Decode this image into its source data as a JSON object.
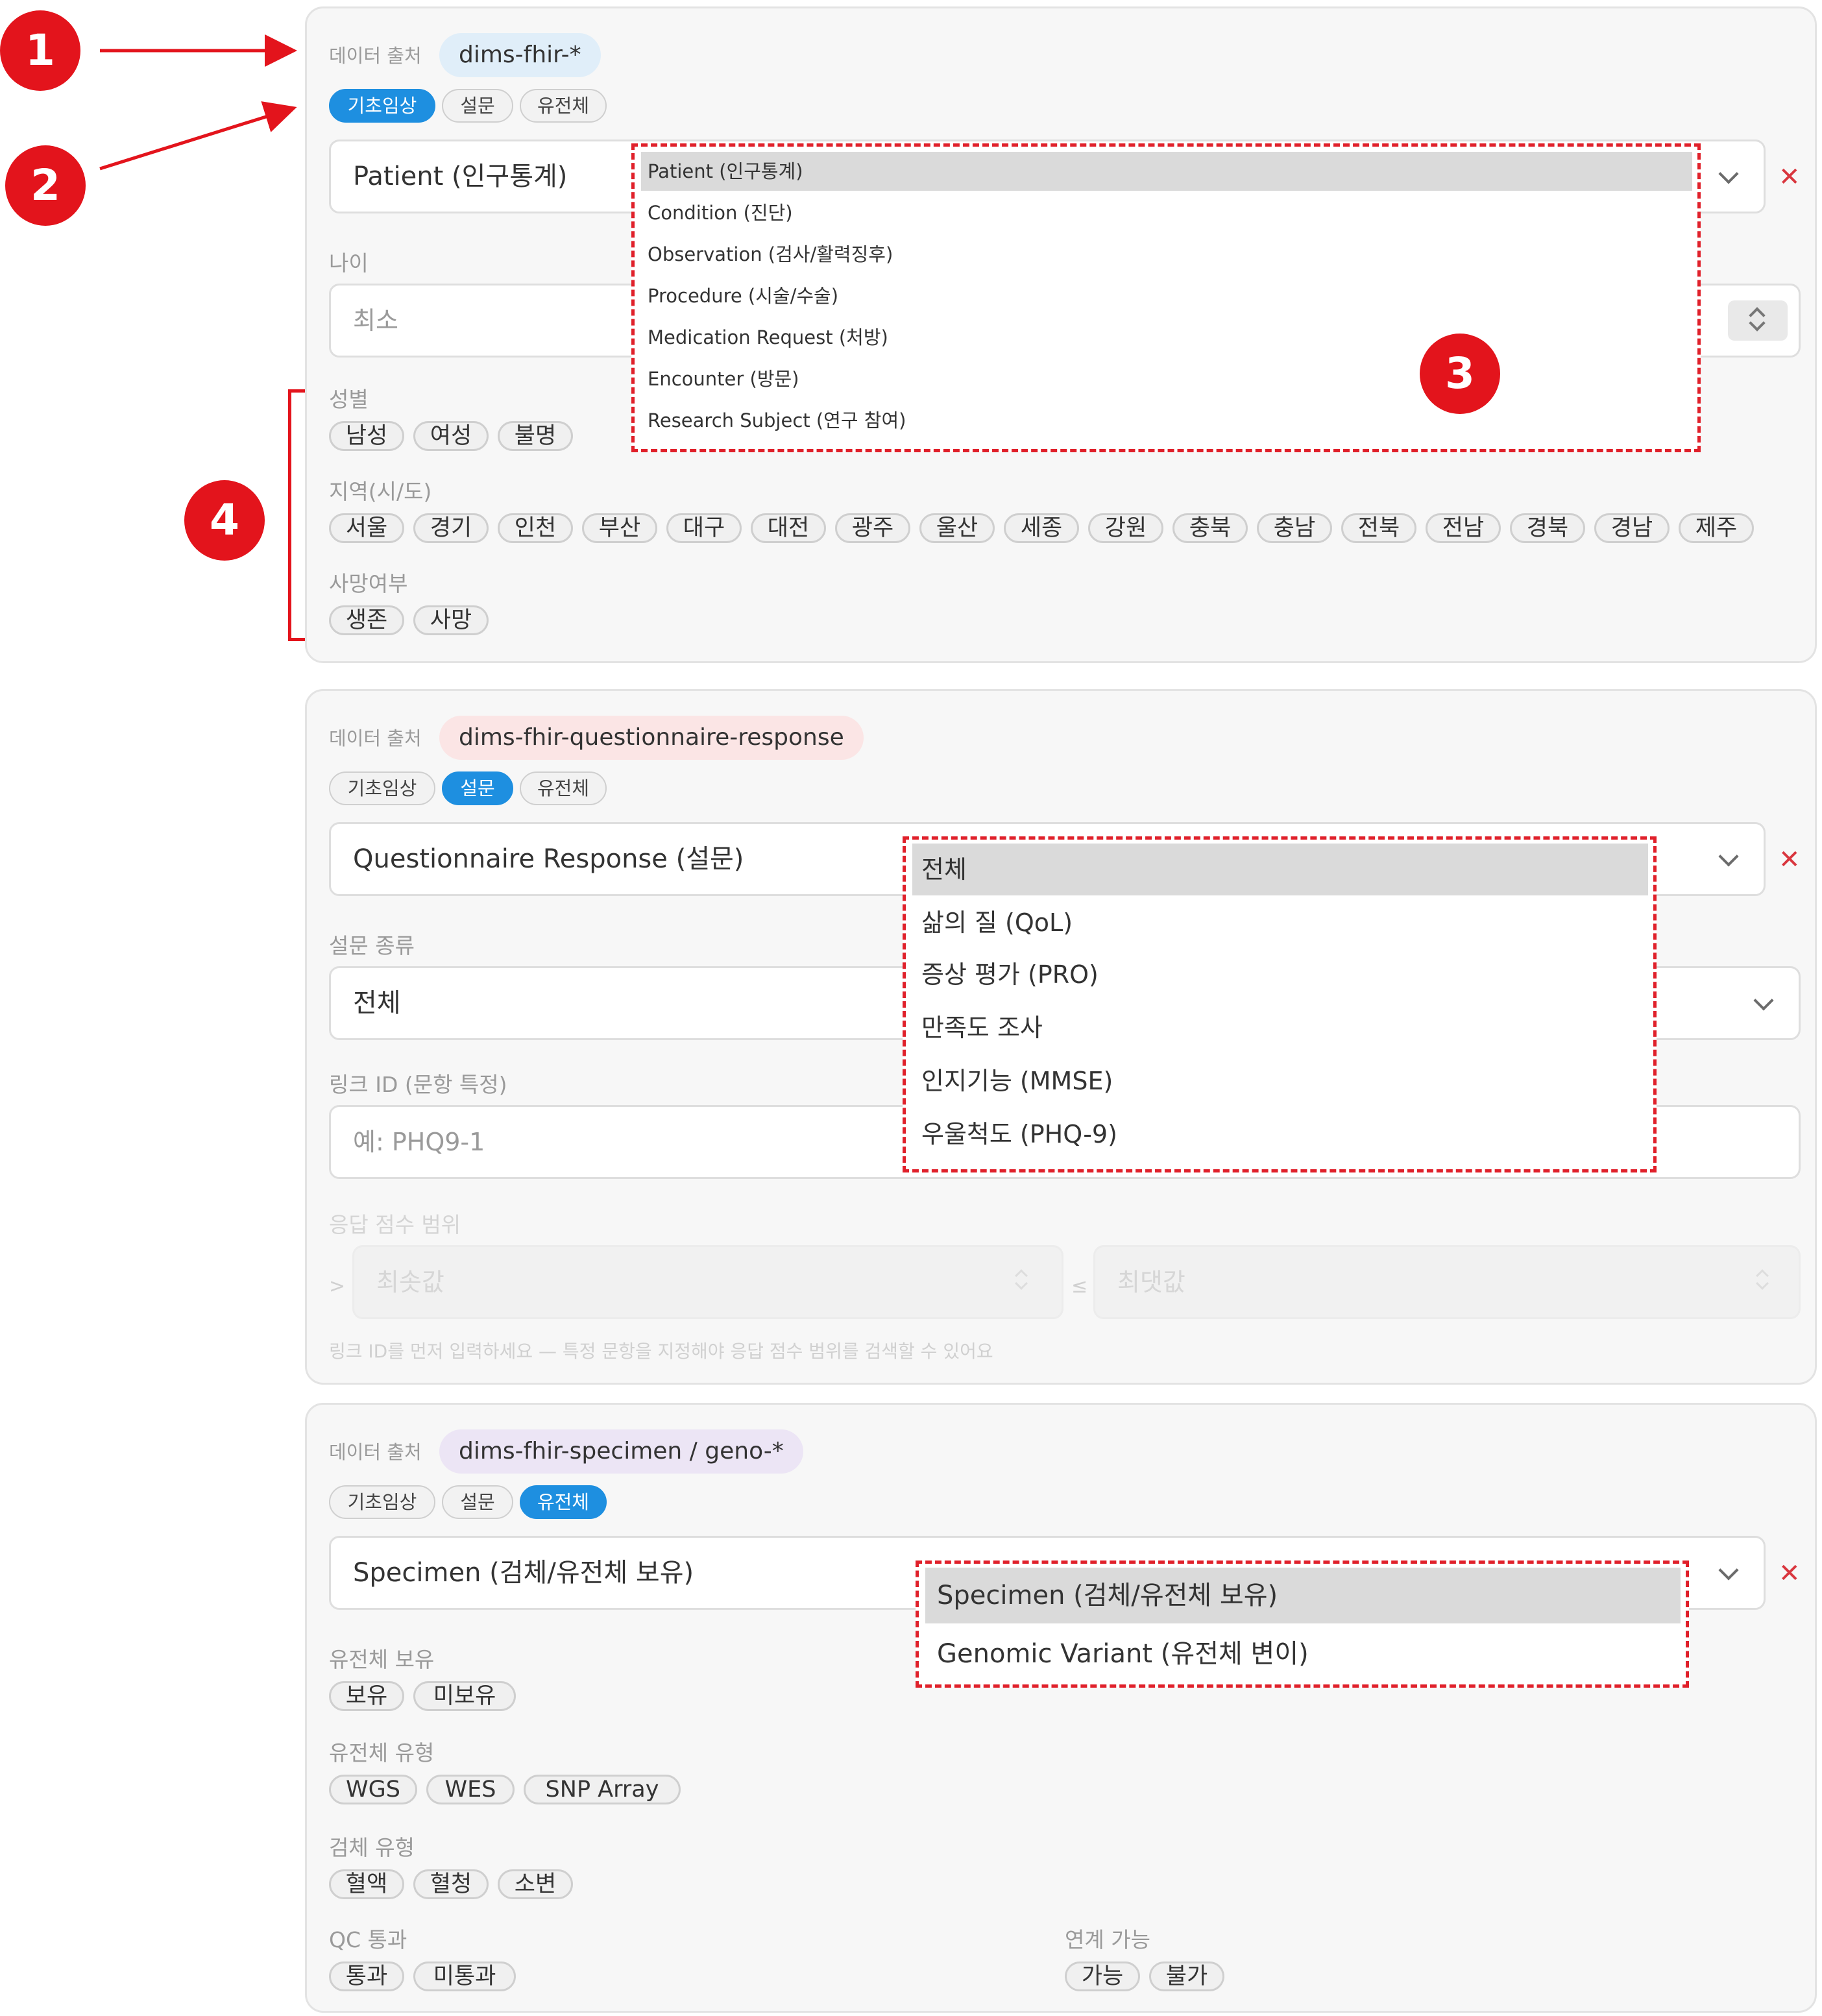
{
  "markers": [
    "1",
    "2",
    "3",
    "4"
  ],
  "source_label": "데이터 출처",
  "tabs": [
    "기초임상",
    "설문",
    "유전체"
  ],
  "panel1": {
    "source_badge": "dims-fhir-*",
    "resource_select": "Patient (인구통계)",
    "resource_options": [
      "Patient (인구통계)",
      "Condition (진단)",
      "Observation (검사/활력징후)",
      "Procedure (시술/수술)",
      "Medication Request (처방)",
      "Encounter (방문)",
      "Research Subject (연구 참여)"
    ],
    "age_label": "나이",
    "age_min_placeholder": "최소",
    "sex_label": "성별",
    "sex_chips": [
      "남성",
      "여성",
      "불명"
    ],
    "region_label": "지역(시/도)",
    "region_chips": [
      "서울",
      "경기",
      "인천",
      "부산",
      "대구",
      "대전",
      "광주",
      "울산",
      "세종",
      "강원",
      "충북",
      "충남",
      "전북",
      "전남",
      "경북",
      "경남",
      "제주"
    ],
    "death_label": "사망여부",
    "death_chips": [
      "생존",
      "사망"
    ]
  },
  "panel2": {
    "source_badge": "dims-fhir-questionnaire-response",
    "resource_select": "Questionnaire Response (설문)",
    "survey_type_label": "설문 종류",
    "survey_type_select": "전체",
    "survey_options": [
      "전체",
      "삶의 질 (QoL)",
      "증상 평가 (PRO)",
      "만족도 조사",
      "인지기능 (MMSE)",
      "우울척도 (PHQ-9)"
    ],
    "link_label": "링크 ID (문항 특정)",
    "link_placeholder": "예: PHQ9-1",
    "score_label": "응답 점수 범위",
    "score_min_op": ">",
    "score_min_placeholder": "최솟값",
    "score_max_op": "≤",
    "score_max_placeholder": "최댓값",
    "helper": "링크 ID를 먼저 입력하세요 — 특정 문항을 지정해야 응답 점수 범위를 검색할 수 있어요"
  },
  "panel3": {
    "source_badge": "dims-fhir-specimen / geno-*",
    "resource_select": "Specimen (검체/유전체 보유)",
    "resource_options": [
      "Specimen (검체/유전체 보유)",
      "Genomic Variant (유전체 변이)"
    ],
    "geno_hold_label": "유전체 보유",
    "geno_hold_chips": [
      "보유",
      "미보유"
    ],
    "geno_type_label": "유전체 유형",
    "geno_type_chips": [
      "WGS",
      "WES",
      "SNP Array"
    ],
    "specimen_type_label": "검체 유형",
    "specimen_type_chips": [
      "혈액",
      "혈청",
      "소변"
    ],
    "qc_label": "QC 통과",
    "qc_chips": [
      "통과",
      "미통과"
    ],
    "link_label": "연계 가능",
    "link_chips": [
      "가능",
      "불가"
    ]
  },
  "colors": {
    "accent": "#1e8fe0",
    "annotation": "#e3141c",
    "close": "#d9363e"
  },
  "icons": {
    "dropdown": "chevron-down-icon",
    "remove": "close-icon",
    "stepper": "stepper-icon"
  }
}
